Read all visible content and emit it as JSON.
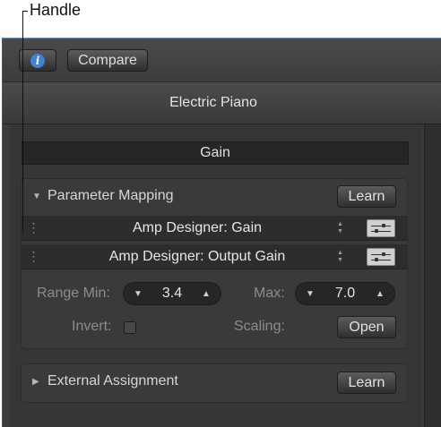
{
  "callout": {
    "label": "Handle"
  },
  "toolbar": {
    "info_icon_glyph": "i",
    "compare_label": "Compare"
  },
  "title": "Electric Piano",
  "section_header": "Gain",
  "parameter_mapping": {
    "title": "Parameter Mapping",
    "expanded": true,
    "learn_label": "Learn",
    "rows": [
      {
        "label": "Amp Designer: Gain"
      },
      {
        "label": "Amp Designer: Output Gain"
      }
    ],
    "range_min": {
      "label": "Range Min:",
      "value": "3.4"
    },
    "max": {
      "label": "Max:",
      "value": "7.0"
    },
    "invert": {
      "label": "Invert:",
      "checked": false
    },
    "scaling": {
      "label": "Scaling:",
      "button_label": "Open"
    }
  },
  "external_assignment": {
    "title": "External Assignment",
    "expanded": false,
    "learn_label": "Learn"
  },
  "colors": {
    "accent": "#3d84d8",
    "window_border": "#6a8fb8"
  },
  "icons": [
    "info-icon",
    "disclosure-triangle-icon",
    "drag-handle-icon",
    "updown-arrows-icon",
    "sliders-icon",
    "decrement-arrow-icon",
    "increment-arrow-icon"
  ]
}
